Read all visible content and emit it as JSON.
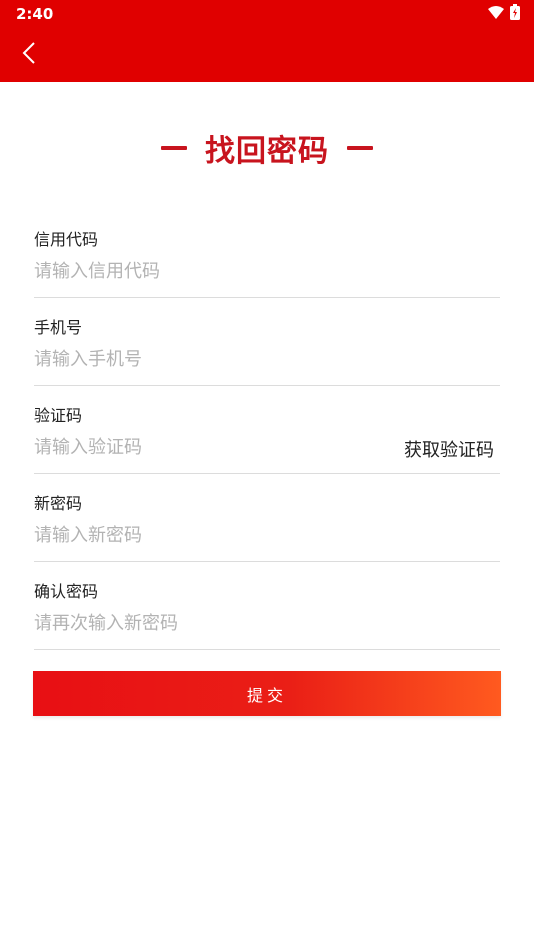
{
  "status_bar": {
    "time": "2:40",
    "icons": [
      "wifi-icon",
      "battery-icon"
    ]
  },
  "app_bar": {
    "back_icon": "chevron-left-icon"
  },
  "page": {
    "title": "找回密码"
  },
  "form": {
    "credit_code": {
      "label": "信用代码",
      "placeholder": "请输入信用代码",
      "value": ""
    },
    "phone": {
      "label": "手机号",
      "placeholder": "请输入手机号",
      "value": ""
    },
    "verify_code": {
      "label": "验证码",
      "placeholder": "请输入验证码",
      "value": "",
      "get_code_label": "获取验证码"
    },
    "new_password": {
      "label": "新密码",
      "placeholder": "请输入新密码",
      "value": ""
    },
    "confirm_password": {
      "label": "确认密码",
      "placeholder": "请再次输入新密码",
      "value": ""
    },
    "submit_label": "提交"
  },
  "colors": {
    "primary": "#e00000",
    "title": "#c8141e",
    "button_gradient_start": "#e80f14",
    "button_gradient_end": "#ff5a1f"
  }
}
